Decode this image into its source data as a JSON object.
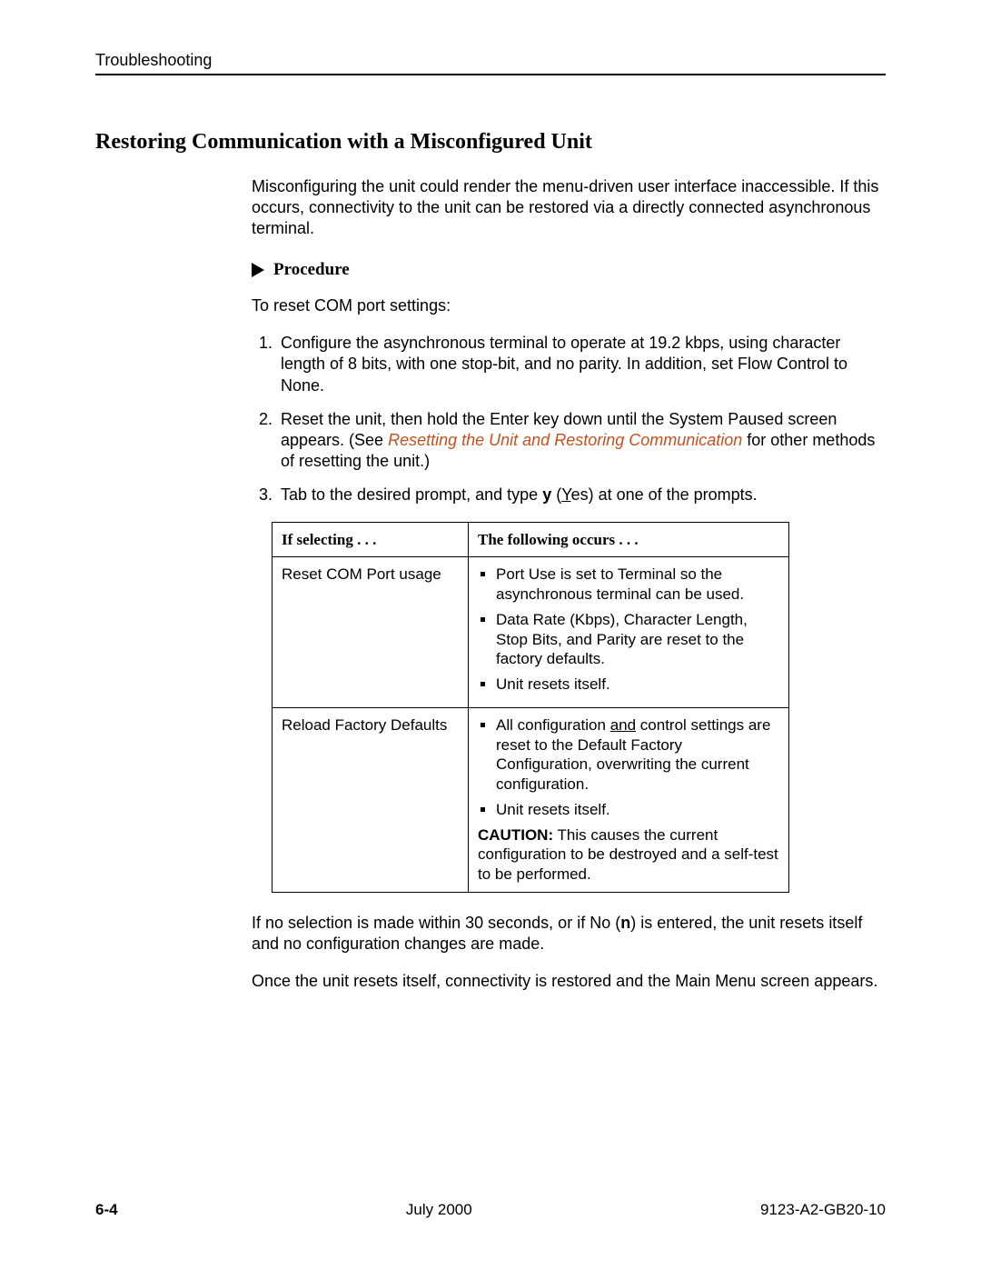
{
  "header": {
    "running": "Troubleshooting"
  },
  "section": {
    "title": "Restoring Communication with a Misconfigured Unit",
    "intro": "Misconfiguring the unit could render the menu-driven user interface inaccessible. If this occurs, connectivity to the unit can be restored via a directly connected asynchronous terminal."
  },
  "procedure": {
    "label": "Procedure",
    "lead": "To reset COM port settings:",
    "steps": {
      "s1": "Configure the asynchronous terminal to operate at 19.2 kbps, using character length of 8 bits, with one stop-bit, and no parity. In addition, set Flow Control to None.",
      "s2_a": "Reset the unit, then hold the Enter key down until the System Paused screen appears. (See ",
      "s2_link": "Resetting the Unit and Restoring Communication",
      "s2_b": " for other methods of resetting the unit.)",
      "s3_a": "Tab to the desired prompt, and type ",
      "s3_y": "y",
      "s3_b": " (",
      "s3_Y": "Y",
      "s3_c": "es) at one of the prompts."
    }
  },
  "table": {
    "head": {
      "c1": "If selecting . . .",
      "c2": "The following occurs . . ."
    },
    "row1": {
      "c1": "Reset COM Port usage",
      "b1": "Port Use is set to Terminal so the asynchronous terminal can be used.",
      "b2": "Data Rate (Kbps), Character Length, Stop Bits, and Parity are reset to the factory defaults.",
      "b3": "Unit resets itself."
    },
    "row2": {
      "c1": "Reload Factory Defaults",
      "b1_a": "All configuration ",
      "b1_u": "and",
      "b1_b": " control settings are reset to the Default Factory Configuration, overwriting the current configuration.",
      "b2": "Unit resets itself.",
      "caution_label": "CAUTION:",
      "caution_text": " This causes the current configuration to be destroyed and a self-test to be performed."
    }
  },
  "after": {
    "p1_a": "If no selection is made within 30 seconds, or if No (",
    "p1_n": "n",
    "p1_b": ") is entered, the unit resets itself and no configuration changes are made.",
    "p2": "Once the unit resets itself, connectivity is restored and the Main Menu screen appears."
  },
  "footer": {
    "page": "6-4",
    "date": "July 2000",
    "doc": "9123-A2-GB20-10"
  }
}
